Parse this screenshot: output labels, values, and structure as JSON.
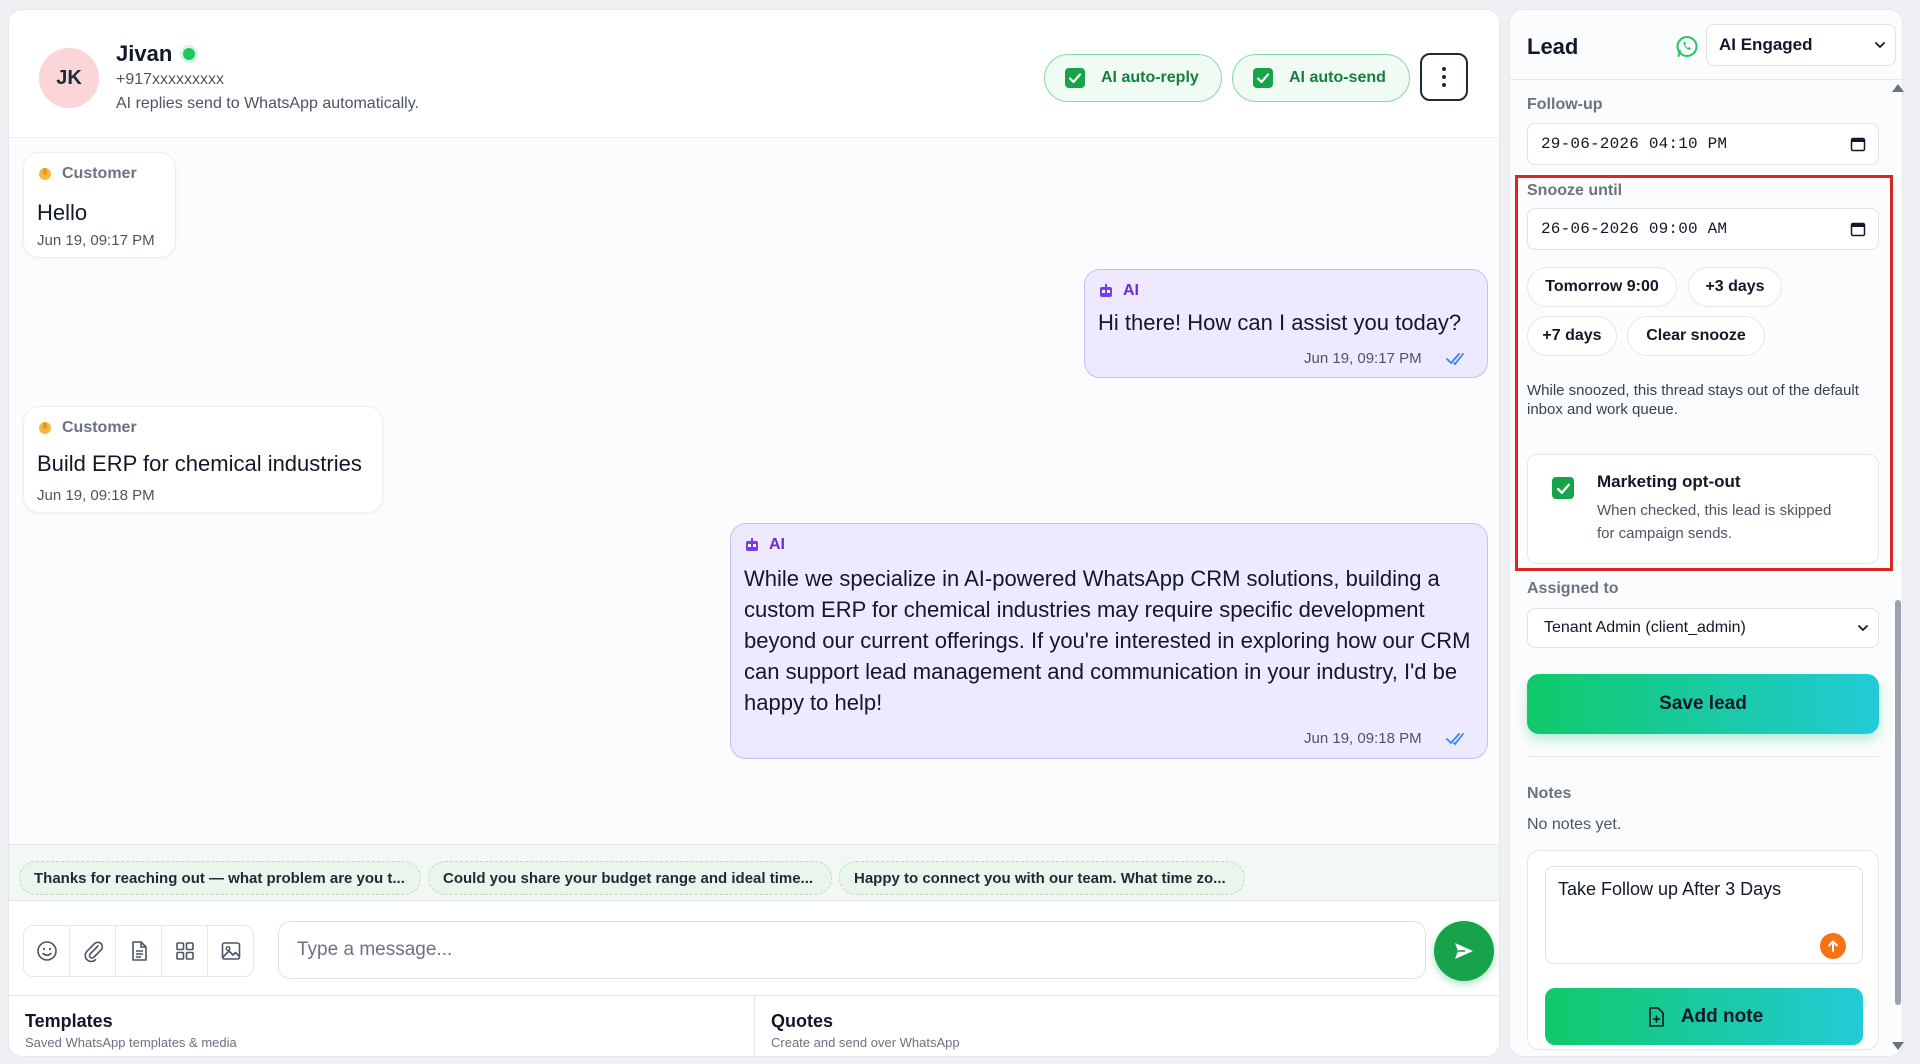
{
  "contact": {
    "initials": "JK",
    "name": "Jivan",
    "phone": "+917xxxxxxxxx",
    "subtitle": "AI replies send to WhatsApp automatically."
  },
  "header": {
    "auto_reply_label": "AI auto-reply",
    "auto_reply_checked": true,
    "auto_send_label": "AI auto-send",
    "auto_send_checked": true,
    "more_icon": "vertical-dots-icon"
  },
  "messages": [
    {
      "sender": "Customer",
      "direction": "in",
      "text": "Hello",
      "time": "Jun 19, 09:17 PM"
    },
    {
      "sender": "AI",
      "direction": "out",
      "text": "Hi there! How can I assist you today?",
      "time": "Jun 19, 09:17 PM"
    },
    {
      "sender": "Customer",
      "direction": "in",
      "text": "Build ERP for chemical industries",
      "time": "Jun 19, 09:18 PM"
    },
    {
      "sender": "AI",
      "direction": "out",
      "text": "While we specialize in AI-powered WhatsApp CRM solutions, building a custom ERP for chemical industries may require specific development beyond our current offerings. If you're interested in exploring how our CRM can support lead management and communication in your industry, I'd be happy to help!",
      "time": "Jun 19, 09:18 PM"
    }
  ],
  "suggestions": [
    "Thanks for reaching out — what problem are you t...",
    "Could you share your budget range and ideal time...",
    "Happy to connect you with our team. What time zo..."
  ],
  "composer": {
    "placeholder": "Type a message...",
    "value": "",
    "tools": [
      "emoji-icon",
      "attach-icon",
      "document-icon",
      "grid-icon",
      "image-icon"
    ]
  },
  "bottom": {
    "templates_title": "Templates",
    "templates_sub": "Saved WhatsApp templates & media",
    "quotes_title": "Quotes",
    "quotes_sub": "Create and send over WhatsApp"
  },
  "lead": {
    "title": "Lead",
    "status": "AI Engaged",
    "followup_label": "Follow-up",
    "followup_value": "29-06-2026 04:10 PM",
    "snooze_label": "Snooze until",
    "snooze_value": "26-06-2026 09:00 AM",
    "quick": [
      "Tomorrow 9:00",
      "+3 days",
      "+7 days",
      "Clear snooze"
    ],
    "snooze_note": "While snoozed, this thread stays out of the default inbox and work queue.",
    "optout_title": "Marketing opt-out",
    "optout_desc": "When checked, this lead is skipped for campaign sends.",
    "optout_checked": true,
    "assigned_label": "Assigned to",
    "assigned_value": "Tenant Admin (client_admin)",
    "save_label": "Save lead",
    "notes_label": "Notes",
    "notes_empty": "No notes yet.",
    "note_draft": "Take Follow up After 3 Days",
    "add_note_label": "Add note"
  },
  "colors": {
    "accent_green": "#16a34a",
    "ai_bubble": "#ede9fe",
    "ai_sender": "#6d28d9",
    "highlight_box": "#dc2626"
  }
}
